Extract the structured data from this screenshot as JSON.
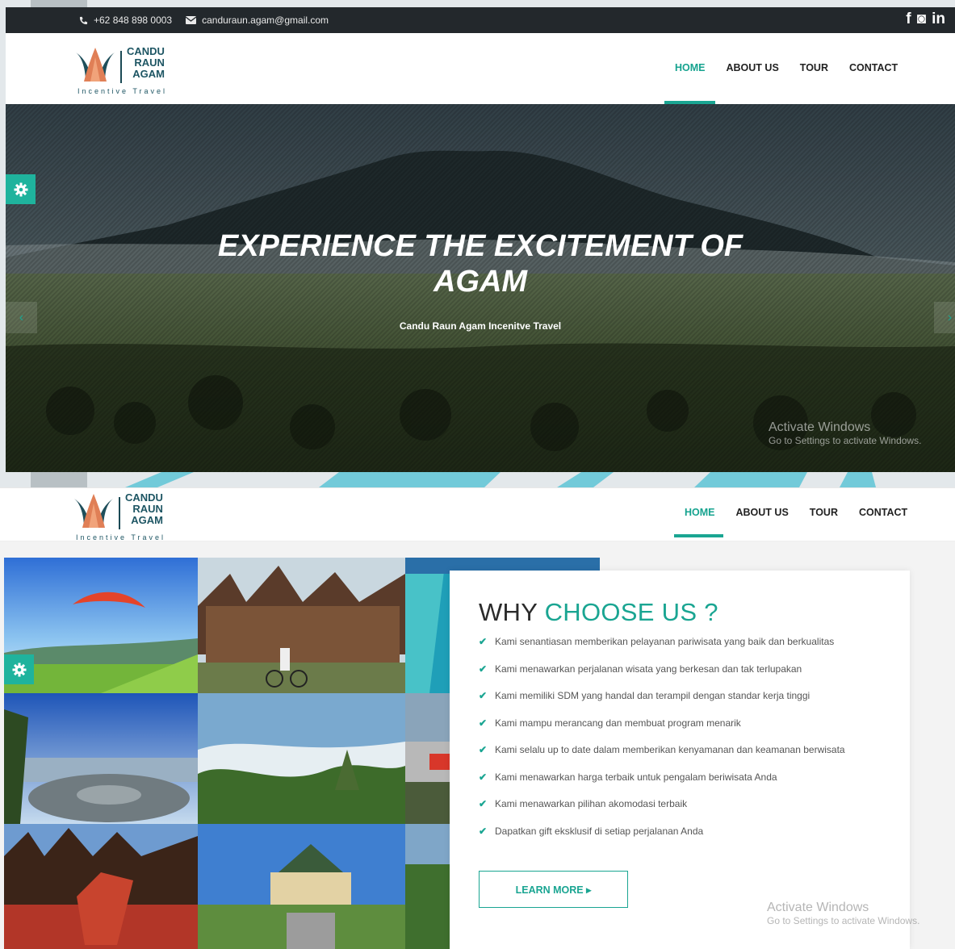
{
  "topbar": {
    "phone": "+62 848 898 0003",
    "email": "canduraun.agam@gmail.com",
    "socials": [
      {
        "icon": "facebook-icon",
        "glyph": "f"
      },
      {
        "icon": "instagram-icon",
        "glyph": "◙"
      },
      {
        "icon": "linkedin-icon",
        "glyph": "in"
      }
    ]
  },
  "logo": {
    "line1": "CANDU",
    "line2": "RAUN",
    "line3": "AGAM",
    "tagline": "Incentive Travel"
  },
  "nav": {
    "items": [
      "HOME",
      "ABOUT US",
      "TOUR",
      "CONTACT"
    ],
    "active": "HOME"
  },
  "hero": {
    "title": "EXPERIENCE THE EXCITEMENT OF AGAM",
    "subtitle": "Candu Raun Agam Incenitve Travel",
    "prev": "‹",
    "next": "›"
  },
  "watermark": {
    "line1": "Activate Windows",
    "line2": "Go to Settings to activate Windows."
  },
  "why": {
    "title_plain": "WHY",
    "title_accent": "CHOOSE US ?",
    "items": [
      "Kami senantiasan memberikan pelayanan pariwisata yang baik dan berkualitas",
      "Kami menawarkan perjalanan wisata yang berkesan dan tak terlupakan",
      "Kami memiliki SDM yang handal dan terampil dengan standar kerja tinggi",
      "Kami mampu merancang dan membuat program menarik",
      "Kami selalu up to date dalam memberikan kenyamanan dan keamanan berwisata",
      "Kami menawarkan harga terbaik untuk pengalam beriwisata Anda",
      "Kami menawarkan pilihan akomodasi terbaik",
      "Dapatkan gift eksklusif di setiap perjalanan Anda"
    ],
    "button": "LEARN MORE ▸"
  },
  "colors": {
    "accent": "#1aa592",
    "dark": "#23282c",
    "logo": "#1d5563"
  }
}
